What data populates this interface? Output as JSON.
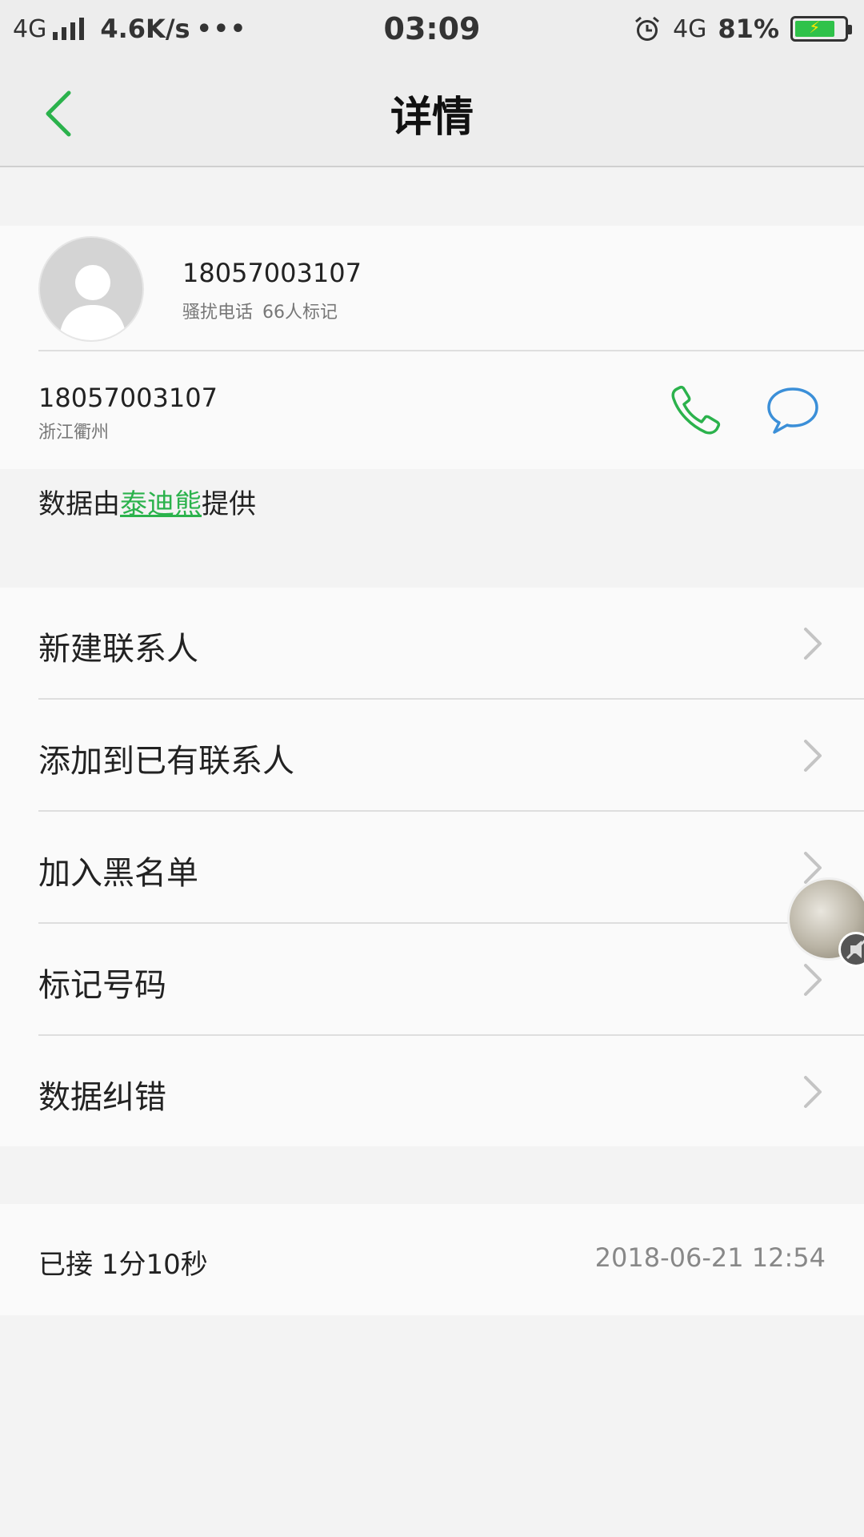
{
  "status_bar": {
    "network_type": "4G",
    "speed": "4.6K/s",
    "dots": "•••",
    "time": "03:09",
    "network_type_right": "4G",
    "battery_percent": "81%",
    "battery_level": 0.81,
    "icons": [
      "signal-icon",
      "alarm-icon",
      "battery-icon"
    ]
  },
  "app_bar": {
    "back_icon": "chevron-left-icon",
    "title": "详情"
  },
  "header": {
    "avatar_icon": "default-avatar-icon",
    "number": "18057003107",
    "tag": "骚扰电话",
    "mark_count": "66人标记"
  },
  "number_row": {
    "number": "18057003107",
    "location": "浙江衢州",
    "call_icon": "phone-icon",
    "message_icon": "message-icon"
  },
  "provider": {
    "prefix": "数据由",
    "link": "泰迪熊",
    "suffix": "提供"
  },
  "actions": [
    {
      "label": "新建联系人"
    },
    {
      "label": "添加到已有联系人"
    },
    {
      "label": "加入黑名单"
    },
    {
      "label": "标记号码"
    },
    {
      "label": "数据纠错"
    }
  ],
  "call_record": {
    "status": "已接 1分10秒",
    "datetime": "2018-06-21 12:54"
  },
  "colors": {
    "accent_green": "#2bb24c",
    "message_blue": "#3b8fd8",
    "background": "#f3f3f3",
    "card": "#fafafa"
  }
}
